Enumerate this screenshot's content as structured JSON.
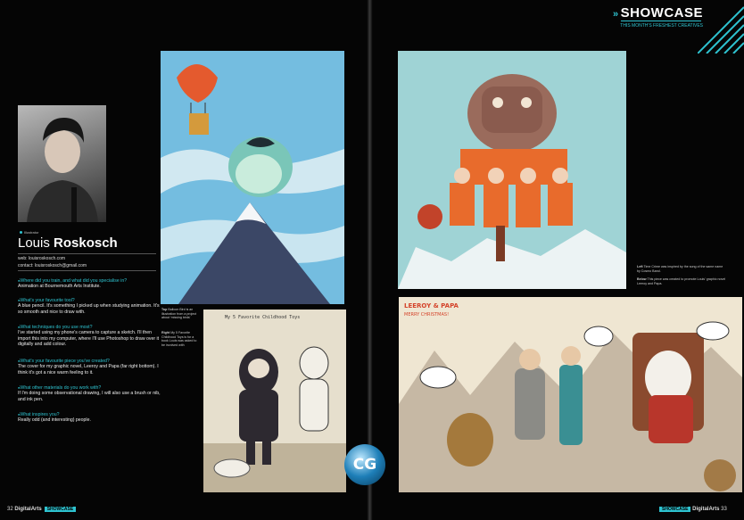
{
  "left_page": {
    "role": "Illustrator",
    "name_first": "Louis",
    "name_last": "Roskosch",
    "web_label": "web: louisroskosch.com",
    "contact_label": "contact: louisroskosch@gmail.com",
    "qa": [
      {
        "q": "Where did you train, and what did you specialise in?",
        "a": "Animation at Bournemouth Arts Institute."
      },
      {
        "q": "What's your favourite tool?",
        "a": "A blue pencil. It's something I picked up when studying animation. It's so smooth and nice to draw with."
      },
      {
        "q": "What techniques do you use most?",
        "a": "I've started using my phone's camera to capture a sketch. I'll then import this into my computer, where I'll use Photoshop to draw over it digitally and add colour."
      },
      {
        "q": "What's your favourite piece you've created?",
        "a": "The cover for my graphic novel, Leeroy and Papa (far right bottom). I think it's got a nice warm feeling to it."
      },
      {
        "q": "What other materials do you work with?",
        "a": "If I'm doing some observational drawing, I will also use a brush or nib, and ink pen."
      },
      {
        "q": "What inspires you?",
        "a": "Really odd (and interesting) people."
      }
    ],
    "caption_top_label": "Top",
    "caption_top": "Balloon Bird is an illustration from a project about 'missing birds'",
    "caption_right_label": "Right",
    "caption_right": "My 5 Favorite Childhood Toys is for a book Louis was asked to be involved with",
    "page_number": "32",
    "footer_brand": "DigitalArts",
    "footer_tag": "SHOWCASE"
  },
  "right_page": {
    "section_title": "SHOWCASE",
    "section_subtitle": "THIS MONTH'S FRESHEST CREATIVES",
    "caption_left_label": "Left",
    "caption_left": "Time Crime was inspired by the song of the same name by Cosmo Band.",
    "caption_below_label": "Below",
    "caption_below": "This piece was created to promote Louis' graphic novel Leeroy and Papa.",
    "page_number": "33",
    "footer_brand": "DigitalArts",
    "footer_tag": "SHOWCASE"
  },
  "artwork": {
    "balloon_bird": "balloon-bird-illustration",
    "toys": "childhood-toys-illustration",
    "time_crime": "time-crime-illustration",
    "leeroy_papa_title": "LEEROY & PAPA",
    "leeroy_papa_greeting": "MERRY CHRISTMAS!",
    "toys_heading": "My 5 Favorite Childhood Toys"
  },
  "logo_text": "CG",
  "accent_color": "#2ec3d0"
}
